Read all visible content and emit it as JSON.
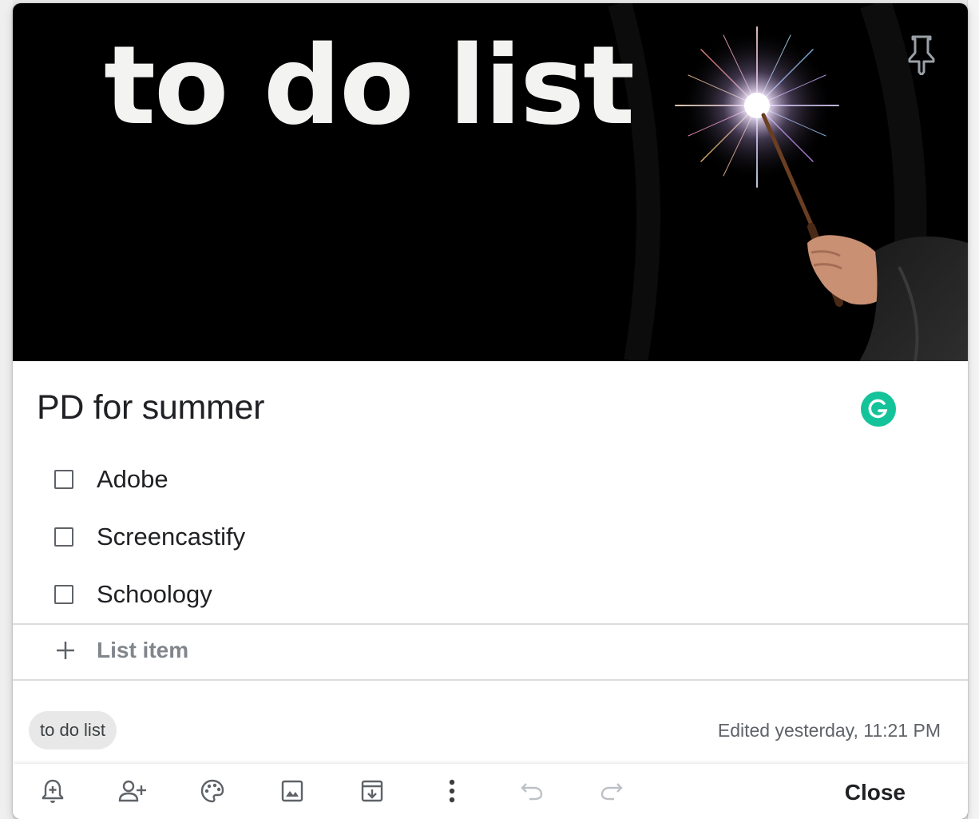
{
  "banner": {
    "heading": "to do list"
  },
  "note": {
    "title": "PD for summer",
    "items": [
      {
        "text": "Adobe",
        "checked": false
      },
      {
        "text": "Screencastify",
        "checked": false
      },
      {
        "text": "Schoology",
        "checked": false
      }
    ],
    "add_item_placeholder": "List item",
    "label": "to do list",
    "edited": "Edited yesterday, 11:21 PM"
  },
  "toolbar": {
    "icons": [
      "remind-me-icon",
      "collaborator-icon",
      "palette-icon",
      "image-icon",
      "archive-icon",
      "more-icon",
      "undo-icon",
      "redo-icon"
    ],
    "close_label": "Close"
  },
  "colors": {
    "grammarly": "#15c39a",
    "text": "#202124",
    "muted": "#5f6368"
  }
}
